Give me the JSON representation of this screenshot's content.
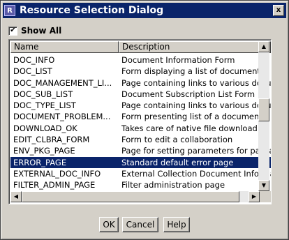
{
  "window": {
    "title": "Resource Selection Dialog",
    "close_glyph": "x",
    "icon_glyph": "R"
  },
  "show_all": {
    "label": "Show All",
    "checked": true,
    "check_glyph": "✔"
  },
  "table": {
    "columns": [
      "Name",
      "Description"
    ],
    "rows": [
      [
        "DOC_INFO",
        "Document Information Form"
      ],
      [
        "DOC_LIST",
        "Form displaying a list of documents"
      ],
      [
        "DOC_MANAGEMENT_LI...",
        "Page containing links to various docum"
      ],
      [
        "DOC_SUB_LIST",
        "Document Subscription List Form"
      ],
      [
        "DOC_TYPE_LIST",
        "Page containing links to various docum"
      ],
      [
        "DOCUMENT_PROBLEM...",
        "Form presenting list of a document's pr"
      ],
      [
        "DOWNLOAD_OK",
        "Takes care of native file download"
      ],
      [
        "EDIT_CLBRA_FORM",
        "Form to edit a collaboration"
      ],
      [
        "ENV_PKG_PAGE",
        "Page for setting parameters for packag"
      ],
      [
        "ERROR_PAGE",
        "Standard default error page"
      ],
      [
        "EXTERNAL_DOC_INFO",
        "External Collection Document Informatio"
      ],
      [
        "FILTER_ADMIN_PAGE",
        "Filter administration page"
      ]
    ],
    "selected_index": 9
  },
  "scroll": {
    "up": "▲",
    "down": "▼",
    "left": "◀",
    "right": "▶",
    "vertical_position": 0.44,
    "vertical_visible": 0.18,
    "horizontal_position": 0.0,
    "horizontal_visible": 0.96
  },
  "buttons": {
    "ok": "OK",
    "cancel": "Cancel",
    "help": "Help"
  }
}
